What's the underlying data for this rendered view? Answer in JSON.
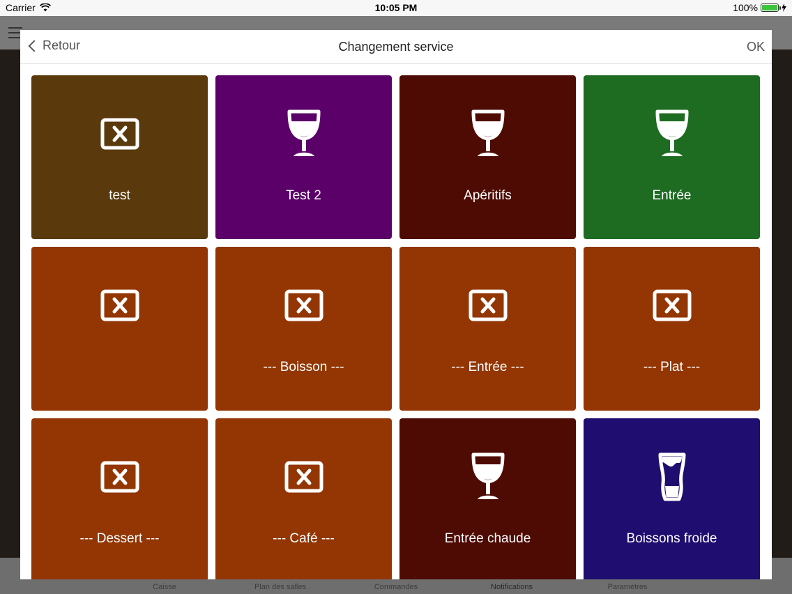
{
  "status_bar": {
    "carrier": "Carrier",
    "time": "10:05 PM",
    "battery": "100%"
  },
  "background_tabs": [
    "Caisse",
    "Plan des salles",
    "Commandes",
    "Notifications",
    "Paramètres"
  ],
  "modal": {
    "back_label": "Retour",
    "title": "Changement service",
    "ok_label": "OK"
  },
  "tiles": [
    {
      "label": "test",
      "color": "#5a3a0c",
      "icon": "no-image-icon"
    },
    {
      "label": "Test 2",
      "color": "#5a0068",
      "icon": "wine-glass-icon"
    },
    {
      "label": "Apéritifs",
      "color": "#4e0b04",
      "icon": "wine-glass-icon"
    },
    {
      "label": "Entrée",
      "color": "#1e6b22",
      "icon": "wine-glass-icon"
    },
    {
      "label": "",
      "color": "#933604",
      "icon": "no-image-icon"
    },
    {
      "label": "--- Boisson ---",
      "color": "#933604",
      "icon": "no-image-icon"
    },
    {
      "label": "--- Entrée ---",
      "color": "#933604",
      "icon": "no-image-icon"
    },
    {
      "label": "--- Plat ---",
      "color": "#933604",
      "icon": "no-image-icon"
    },
    {
      "label": "--- Dessert ---",
      "color": "#933604",
      "icon": "no-image-icon"
    },
    {
      "label": "--- Café ---",
      "color": "#933604",
      "icon": "no-image-icon"
    },
    {
      "label": "Entrée chaude",
      "color": "#4e0b04",
      "icon": "wine-glass-icon"
    },
    {
      "label": "Boissons froide",
      "color": "#1f0e70",
      "icon": "beer-glass-icon"
    }
  ]
}
